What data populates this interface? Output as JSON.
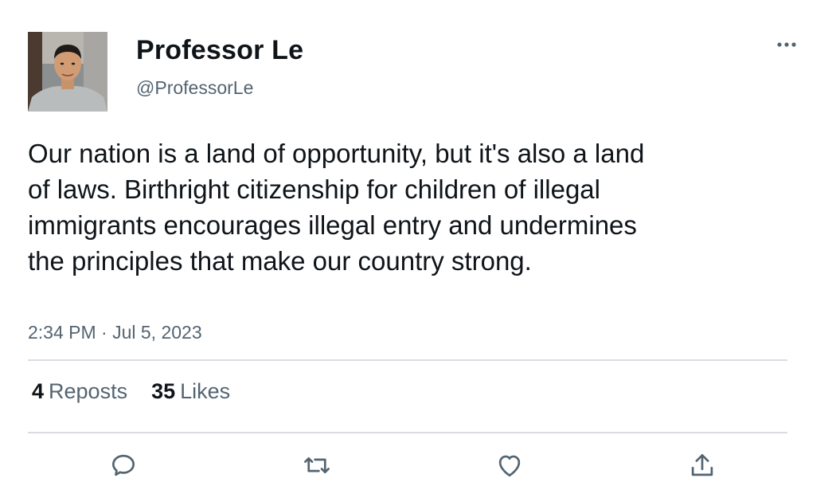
{
  "author": {
    "display_name": "Professor Le",
    "handle": "@ProfessorLe",
    "avatar_icon": "avatar-photo"
  },
  "tweet": {
    "text": "Our nation is a land of opportunity, but it's also a land of laws. Birthright citizenship for children of illegal immigrants encourages illegal entry and undermines the principles that make our country strong.",
    "timestamp": "2:34 PM · Jul 5, 2023"
  },
  "stats": {
    "reposts_count": "4",
    "reposts_label": "Reposts",
    "likes_count": "35",
    "likes_label": "Likes"
  },
  "actions": {
    "icons": [
      "reply-icon",
      "repost-icon",
      "like-icon",
      "share-icon"
    ]
  },
  "colors": {
    "text_primary": "#0f1419",
    "text_secondary": "#536471",
    "divider": "#d9dde1"
  }
}
